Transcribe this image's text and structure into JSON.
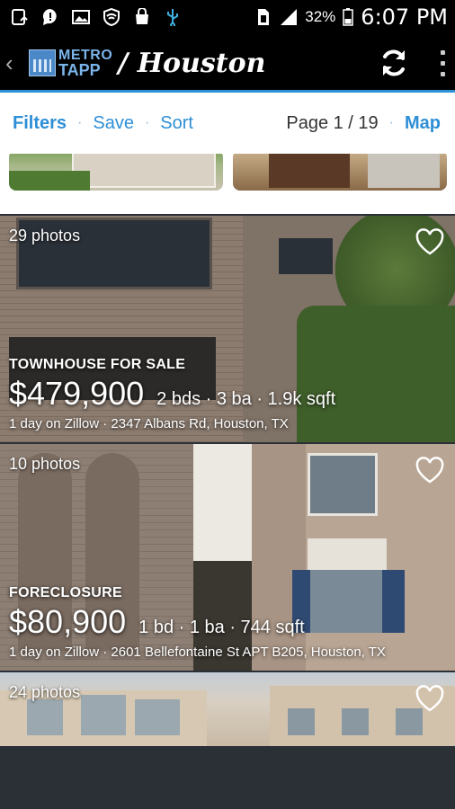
{
  "status_bar": {
    "battery": "32%",
    "time": "6:07 PM"
  },
  "app_bar": {
    "logo_line1": "METRO",
    "logo_line2": "TAPP",
    "separator": "/",
    "city": "Houston"
  },
  "toolbar": {
    "filters": "Filters",
    "save": "Save",
    "sort": "Sort",
    "separator": "·",
    "page": "Page 1 / 19",
    "map": "Map"
  },
  "listings": [
    {
      "photo_count": "29 photos",
      "type": "TOWNHOUSE FOR SALE",
      "price": "$479,900",
      "specs": "2 bds · 3 ba · 1.9k sqft",
      "days": "1 day on Zillow",
      "address": "2347 Albans Rd, Houston, TX"
    },
    {
      "photo_count": "10 photos",
      "type": "FORECLOSURE",
      "price": "$80,900",
      "specs": "1 bd · 1 ba · 744 sqft",
      "days": "1 day on Zillow",
      "address": "2601 Bellefontaine St APT B205, Houston, TX"
    },
    {
      "photo_count": "24 photos"
    }
  ]
}
